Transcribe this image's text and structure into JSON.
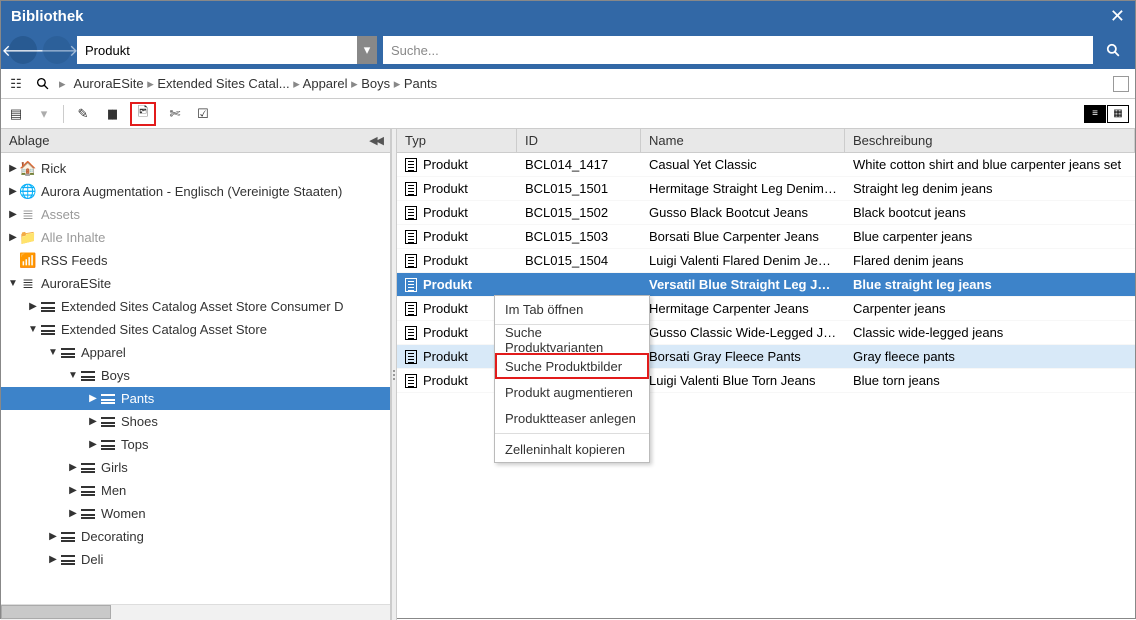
{
  "window": {
    "title": "Bibliothek"
  },
  "nav": {
    "dropdown_value": "Produkt",
    "search_placeholder": "Suche..."
  },
  "breadcrumb": [
    "AuroraESite",
    "Extended Sites Catal...",
    "Apparel",
    "Boys",
    "Pants"
  ],
  "sidebar": {
    "header": "Ablage",
    "items": [
      {
        "caret": "▶",
        "icon": "home",
        "label": "Rick",
        "indent": 0
      },
      {
        "caret": "▶",
        "icon": "globe",
        "label": "Aurora Augmentation - Englisch (Vereinigte Staaten)",
        "indent": 0
      },
      {
        "caret": "▶",
        "icon": "db-g",
        "label": "Assets",
        "indent": 0,
        "gray": true
      },
      {
        "caret": "▶",
        "icon": "folder",
        "label": "Alle Inhalte",
        "indent": 0,
        "gray": true
      },
      {
        "caret": "",
        "icon": "rss",
        "label": "RSS Feeds",
        "indent": 0
      },
      {
        "caret": "▼",
        "icon": "db",
        "label": "AuroraESite",
        "indent": 0
      },
      {
        "caret": "▶",
        "icon": "list",
        "label": "Extended Sites Catalog Asset Store Consumer D",
        "indent": 1
      },
      {
        "caret": "▼",
        "icon": "list",
        "label": "Extended Sites Catalog Asset Store",
        "indent": 1
      },
      {
        "caret": "▼",
        "icon": "lines",
        "label": "Apparel",
        "indent": 2
      },
      {
        "caret": "▼",
        "icon": "lines",
        "label": "Boys",
        "indent": 3
      },
      {
        "caret": "▶",
        "icon": "lines",
        "label": "Pants",
        "indent": 4,
        "selected": true
      },
      {
        "caret": "▶",
        "icon": "lines",
        "label": "Shoes",
        "indent": 4
      },
      {
        "caret": "▶",
        "icon": "lines",
        "label": "Tops",
        "indent": 4
      },
      {
        "caret": "▶",
        "icon": "lines",
        "label": "Girls",
        "indent": 3
      },
      {
        "caret": "▶",
        "icon": "lines",
        "label": "Men",
        "indent": 3
      },
      {
        "caret": "▶",
        "icon": "lines",
        "label": "Women",
        "indent": 3
      },
      {
        "caret": "▶",
        "icon": "lines",
        "label": "Decorating",
        "indent": 2
      },
      {
        "caret": "▶",
        "icon": "lines",
        "label": "Deli",
        "indent": 2
      }
    ]
  },
  "grid": {
    "columns": {
      "typ": "Typ",
      "id": "ID",
      "name": "Name",
      "desc": "Beschreibung"
    },
    "type_label": "Produkt",
    "rows": [
      {
        "id": "BCL014_1417",
        "name": "Casual Yet Classic",
        "desc": "White cotton shirt and blue carpenter jeans set"
      },
      {
        "id": "BCL015_1501",
        "name": "Hermitage Straight Leg Denim ...",
        "desc": "Straight leg denim jeans"
      },
      {
        "id": "BCL015_1502",
        "name": "Gusso Black Bootcut Jeans",
        "desc": "Black bootcut jeans"
      },
      {
        "id": "BCL015_1503",
        "name": "Borsati Blue Carpenter Jeans",
        "desc": "Blue carpenter jeans"
      },
      {
        "id": "BCL015_1504",
        "name": "Luigi Valenti Flared Denim Jeans",
        "desc": "Flared denim jeans"
      },
      {
        "id": "",
        "name": "Versatil Blue Straight Leg Jeans",
        "desc": "Blue straight leg jeans",
        "selected": true
      },
      {
        "id": "",
        "name": "Hermitage Carpenter Jeans",
        "desc": "Carpenter jeans"
      },
      {
        "id": "",
        "name": "Gusso Classic Wide-Legged Je...",
        "desc": "Classic wide-legged jeans"
      },
      {
        "id": "",
        "name": "Borsati Gray Fleece Pants",
        "desc": "Gray fleece pants",
        "hover": true
      },
      {
        "id": "",
        "name": "Luigi Valenti Blue Torn Jeans",
        "desc": "Blue torn jeans"
      }
    ]
  },
  "context_menu": {
    "items": [
      "Im Tab öffnen",
      "Suche Produktvarianten",
      "Suche Produktbilder",
      "Produkt augmentieren",
      "Produktteaser anlegen",
      "Zelleninhalt kopieren"
    ],
    "highlight_index": 2,
    "sep_after": [
      0,
      4
    ]
  }
}
